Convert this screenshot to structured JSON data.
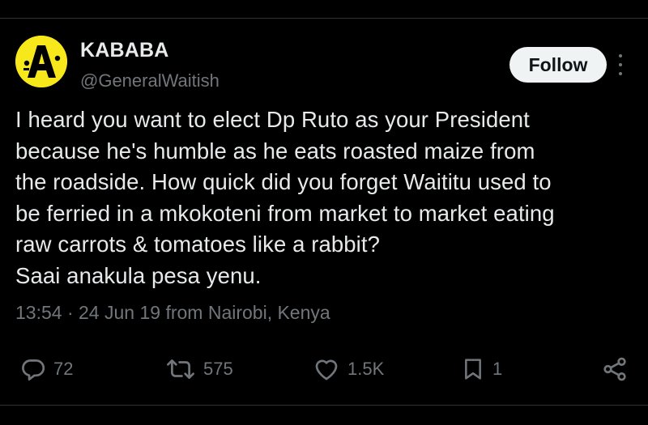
{
  "tweet": {
    "display_name": "KABABA",
    "handle": "@GeneralWaitish",
    "follow_label": "Follow",
    "text_lines": [
      "I heard you want to elect Dp Ruto as your President",
      "because he's humble as he eats roasted maize from",
      "the roadside. How quick did you forget Waititu used to",
      "be ferried in a mkokoteni from market to market eating",
      "raw carrots & tomatoes like a rabbit?",
      "Saai anakula pesa yenu."
    ],
    "time": "13:54",
    "separator": "·",
    "date": "24 Jun 19",
    "location": "from Nairobi, Kenya"
  },
  "actions": {
    "reply_count": "72",
    "retweet_count": "575",
    "like_count": "1.5K",
    "bookmark_count": "1"
  },
  "icons": {
    "avatar": "logo-avatar-icon",
    "more": "more-options-icon",
    "reply": "reply-icon",
    "retweet": "retweet-icon",
    "like": "heart-icon",
    "bookmark": "bookmark-icon",
    "share": "share-icon"
  },
  "colors": {
    "background": "#000000",
    "text_primary": "#e7e9ea",
    "text_secondary": "#71767b",
    "follow_bg": "#eff3f4",
    "avatar_bg": "#f7e81c"
  }
}
